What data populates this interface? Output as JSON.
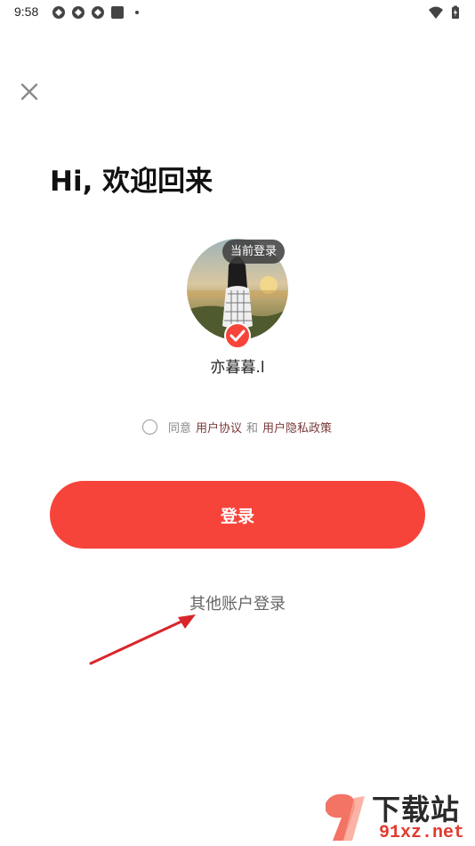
{
  "status_bar": {
    "time": "9:58",
    "icons": [
      "notification-icon",
      "notification-icon",
      "notification-icon",
      "app-icon",
      "dot-icon"
    ],
    "right_icons": [
      "wifi-icon",
      "battery-icon"
    ]
  },
  "header": {
    "close_icon": "close-icon",
    "welcome_title": "Hi, 欢迎回来"
  },
  "account": {
    "badge_current": "当前登录",
    "username": "亦暮暮.l"
  },
  "agreement": {
    "prefix": "同意",
    "user_agreement": "用户协议",
    "and": "和",
    "privacy_policy": "用户隐私政策"
  },
  "actions": {
    "login_label": "登录",
    "other_login_label": "其他账户登录"
  },
  "watermark": {
    "line1": "下载站",
    "line2": "91xz.net"
  },
  "colors": {
    "accent": "#f7443b",
    "link": "#7a3a3a"
  }
}
